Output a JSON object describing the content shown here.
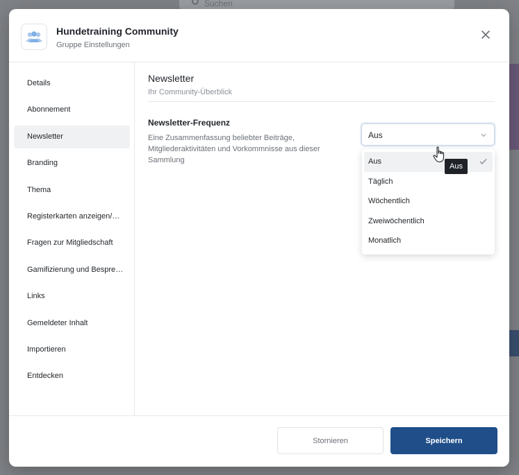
{
  "background": {
    "search_placeholder": "Suchen"
  },
  "header": {
    "title": "Hundetraining Community",
    "subtitle": "Gruppe Einstellungen",
    "logo_icon": "group-icon",
    "close_icon": "close-icon"
  },
  "sidebar": {
    "items": [
      {
        "label": "Details",
        "active": false
      },
      {
        "label": "Abonnement",
        "active": false
      },
      {
        "label": "Newsletter",
        "active": true
      },
      {
        "label": "Branding",
        "active": false
      },
      {
        "label": "Thema",
        "active": false
      },
      {
        "label": "Registerkarten anzeigen/…",
        "active": false
      },
      {
        "label": "Fragen zur Mitgliedschaft",
        "active": false
      },
      {
        "label": "Gamifizierung und Bespre…",
        "active": false
      },
      {
        "label": "Links",
        "active": false
      },
      {
        "label": "Gemeldeter Inhalt",
        "active": false
      },
      {
        "label": "Importieren",
        "active": false
      },
      {
        "label": "Entdecken",
        "active": false
      }
    ]
  },
  "main": {
    "title": "Newsletter",
    "subtitle": "Ihr Community-Überblick",
    "frequency": {
      "label": "Newsletter-Frequenz",
      "description": "Eine Zusammenfassung beliebter Beiträge, Mitgliederaktivitäten und Vorkommnisse aus dieser Sammlung",
      "selected": "Aus",
      "options": [
        "Aus",
        "Täglich",
        "Wöchentlich",
        "Zweiwöchentlich",
        "Monatlich"
      ],
      "tooltip": "Aus"
    }
  },
  "footer": {
    "cancel_label": "Stornieren",
    "save_label": "Speichern"
  },
  "colors": {
    "primary": "#1f4e89",
    "overlay": "#8a8d91",
    "hover": "#eff1f3"
  }
}
